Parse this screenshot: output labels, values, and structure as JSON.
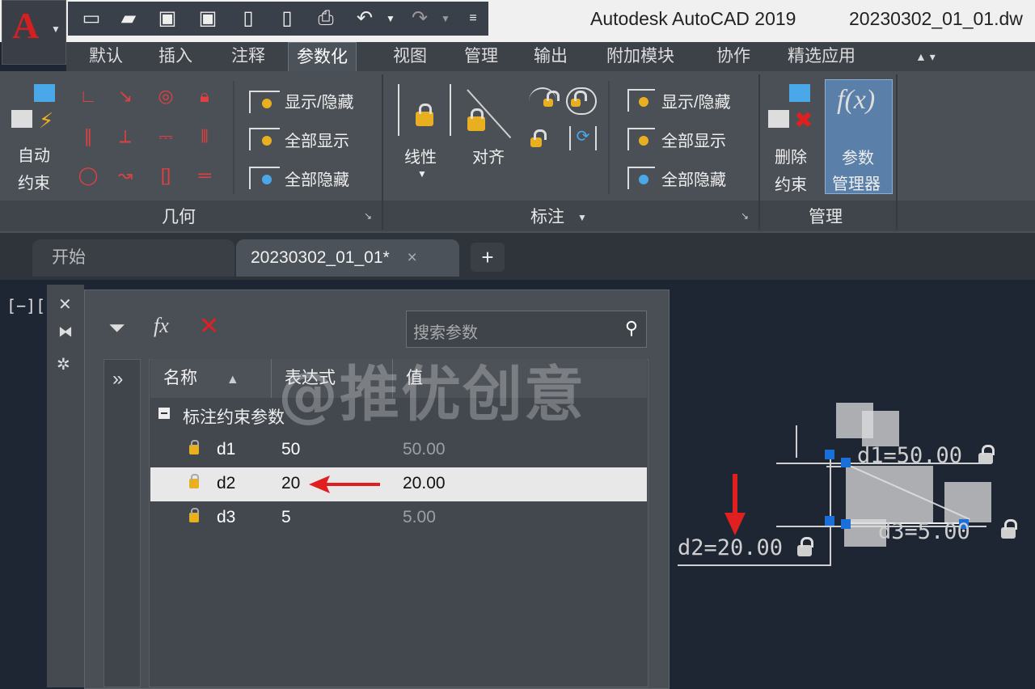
{
  "app": {
    "title": "Autodesk AutoCAD 2019",
    "file_title": "20230302_01_01.dw",
    "app_button_letter": "A"
  },
  "ribbon": {
    "tabs": [
      "默认",
      "插入",
      "注释",
      "参数化",
      "视图",
      "管理",
      "输出",
      "附加模块",
      "协作",
      "精选应用"
    ],
    "active_tab": "参数化",
    "geometry": {
      "auto_constrain_label_1": "自动",
      "auto_constrain_label_2": "约束",
      "show_hide": "显示/隐藏",
      "show_all": "全部显示",
      "hide_all": "全部隐藏",
      "panel_title": "几何"
    },
    "dimensional": {
      "linear": "线性",
      "aligned": "对齐",
      "show_hide": "显示/隐藏",
      "show_all": "全部显示",
      "hide_all": "全部隐藏",
      "panel_title": "标注"
    },
    "manage": {
      "delete_label_1": "删除",
      "delete_label_2": "约束",
      "params_label_1": "参数",
      "params_label_2": "管理器",
      "panel_title": "管理",
      "fx": "f(x)"
    }
  },
  "file_tabs": {
    "start": "开始",
    "current": "20230302_01_01*",
    "close": "×",
    "add": "+"
  },
  "viewport_label": "[−][",
  "parameters_manager": {
    "search_placeholder": "搜索参数",
    "expand": "»",
    "columns": {
      "name": "名称",
      "expression": "表达式",
      "value": "值"
    },
    "group_label": "标注约束参数",
    "rows": [
      {
        "name": "d1",
        "expression": "50",
        "value": "50.00",
        "selected": false
      },
      {
        "name": "d2",
        "expression": "20",
        "value": "20.00",
        "selected": true
      },
      {
        "name": "d3",
        "expression": "5",
        "value": "5.00",
        "selected": false
      }
    ]
  },
  "watermark": "@推优创意",
  "drawing": {
    "d1_label": "d1=50.00",
    "d2_label": "d2=20.00",
    "d3_label": "d3=5.00"
  },
  "colors": {
    "accent_red": "#e02020",
    "grip_blue": "#1a6fd8",
    "lock_gold": "#e8b020"
  }
}
